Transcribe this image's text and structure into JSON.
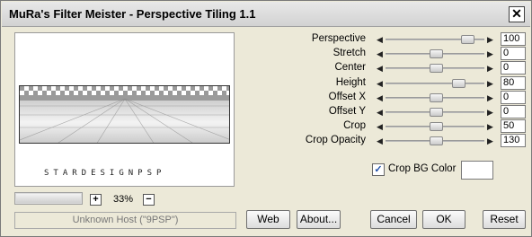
{
  "window": {
    "title": "MuRa's Filter Meister - Perspective Tiling 1.1",
    "close_glyph": "✕"
  },
  "preview": {
    "watermark": "STARDESIGNPSP",
    "zoom": "33%",
    "zoom_in": "+",
    "zoom_out": "−"
  },
  "status": {
    "host_text": "Unknown Host (\"9PSP\")"
  },
  "params": [
    {
      "label": "Perspective",
      "value": "100",
      "level": 0.88
    },
    {
      "label": "Stretch",
      "value": "0",
      "level": 0.52
    },
    {
      "label": "Center",
      "value": "0",
      "level": 0.52
    },
    {
      "label": "Height",
      "value": "80",
      "level": 0.78
    },
    {
      "label": "Offset X",
      "value": "0",
      "level": 0.52
    },
    {
      "label": "Offset Y",
      "value": "0",
      "level": 0.52
    },
    {
      "label": "Crop",
      "value": "50",
      "level": 0.52
    },
    {
      "label": "Crop Opacity",
      "value": "130",
      "level": 0.52
    }
  ],
  "crop_bg": {
    "label": "Crop BG Color",
    "checked": true,
    "swatch": "#ffffff"
  },
  "buttons": {
    "web": "Web",
    "about": "About...",
    "cancel": "Cancel",
    "ok": "OK",
    "reset": "Reset"
  },
  "colors": {
    "dialog_bg": "#ece9d8",
    "checker_dark": "#9a9a9a",
    "checker_light": "#ffffff"
  }
}
